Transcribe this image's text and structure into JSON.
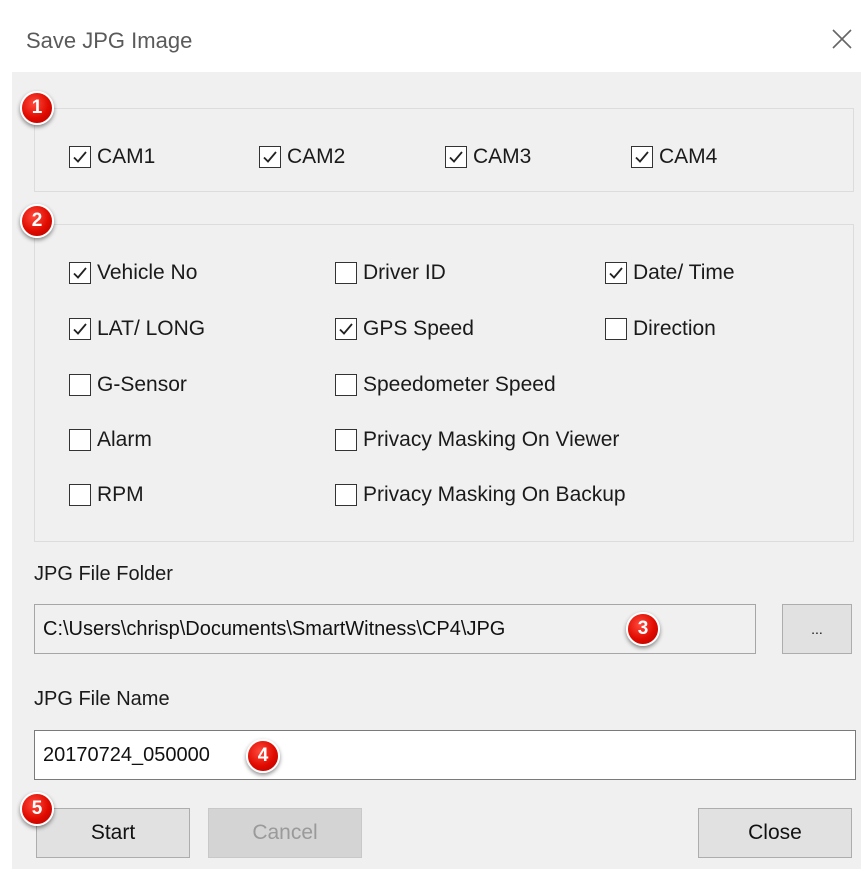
{
  "window": {
    "title": "Save JPG Image",
    "close_icon": "close-icon"
  },
  "markers": [
    "1",
    "2",
    "3",
    "4",
    "5"
  ],
  "cameras": [
    {
      "label": "CAM1",
      "checked": true
    },
    {
      "label": "CAM2",
      "checked": true
    },
    {
      "label": "CAM3",
      "checked": true
    },
    {
      "label": "CAM4",
      "checked": true
    }
  ],
  "overlay_options": [
    {
      "label": "Vehicle No",
      "checked": true
    },
    {
      "label": "Driver ID",
      "checked": false
    },
    {
      "label": "Date/ Time",
      "checked": true
    },
    {
      "label": "LAT/ LONG",
      "checked": true
    },
    {
      "label": "GPS Speed",
      "checked": true
    },
    {
      "label": "Direction",
      "checked": false
    },
    {
      "label": "G-Sensor",
      "checked": false
    },
    {
      "label": "Speedometer Speed",
      "checked": false
    },
    {
      "label": "Alarm",
      "checked": false
    },
    {
      "label": "Privacy Masking On Viewer",
      "checked": false
    },
    {
      "label": "RPM",
      "checked": false
    },
    {
      "label": "Privacy Masking On Backup",
      "checked": false
    }
  ],
  "folder": {
    "label": "JPG File Folder",
    "value": "C:\\Users\\chrisp\\Documents\\SmartWitness\\CP4\\JPG",
    "browse_label": "..."
  },
  "file_name": {
    "label": "JPG File Name",
    "value": "20170724_050000"
  },
  "buttons": {
    "start": "Start",
    "cancel": "Cancel",
    "close": "Close"
  },
  "colors": {
    "marker_red": "#e00b00",
    "dialog_bg": "#f0f0f0",
    "button_bg": "#e1e1e1"
  }
}
